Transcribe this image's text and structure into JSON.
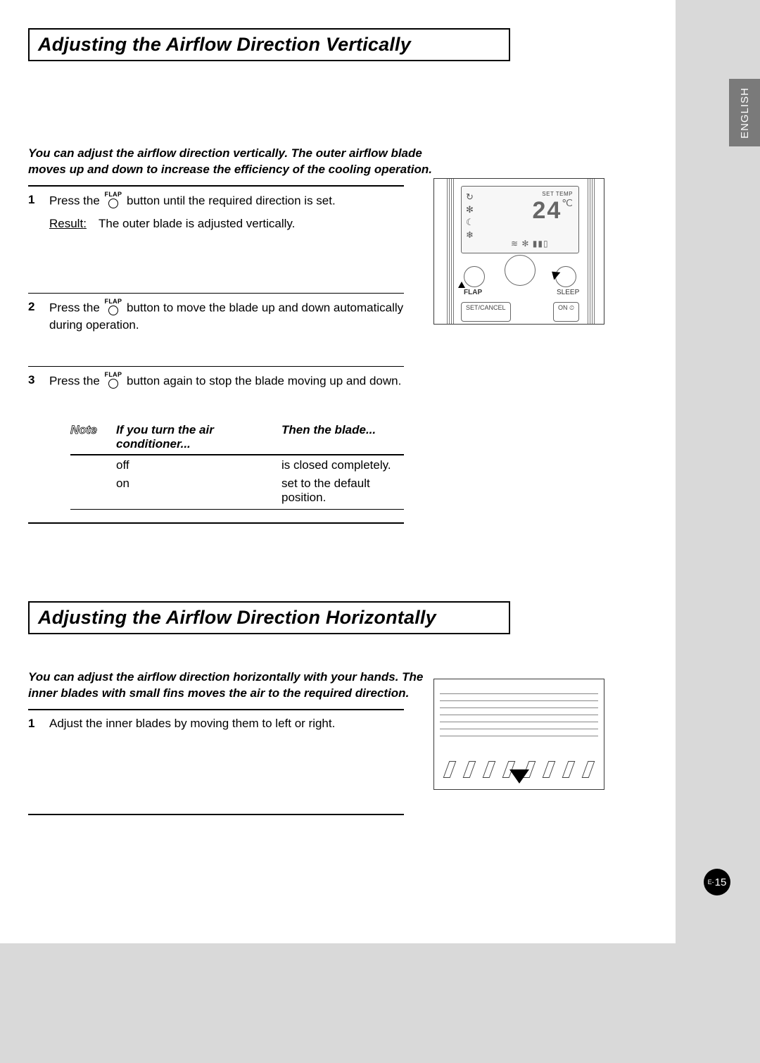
{
  "language_tab": "ENGLISH",
  "page_number": {
    "prefix": "E-",
    "num": "15"
  },
  "icons": {
    "flap_button_label": "FLAP"
  },
  "section1": {
    "title": "Adjusting the Airflow Direction Vertically",
    "intro": "You can adjust the airflow direction vertically. The outer airflow blade moves up and down to increase the efficiency of the cooling operation.",
    "steps": [
      {
        "num": "1",
        "pre": "Press the ",
        "post": " button until the required direction is set.",
        "result_label": "Result",
        "result_text": "The outer blade is adjusted vertically."
      },
      {
        "num": "2",
        "pre": "Press the ",
        "post": " button to move the blade up and down automatically during operation."
      },
      {
        "num": "3",
        "pre": "Press the ",
        "post": " button again to stop the blade moving up and down."
      }
    ],
    "note": {
      "label": "Note",
      "headers": [
        "If you turn the air conditioner...",
        "Then the blade..."
      ],
      "rows": [
        {
          "c1": "off",
          "c2": "is closed completely."
        },
        {
          "c1": "on",
          "c2": "set to the default position."
        }
      ]
    },
    "figure": {
      "set_temp_label": "SET TEMP",
      "temp_value": "24",
      "temp_unit": "℃",
      "flap_label": "FLAP",
      "sleep_label": "SLEEP",
      "set_cancel": "SET/CANCEL",
      "on_label": "ON ⏲"
    }
  },
  "section2": {
    "title": "Adjusting the Airflow Direction Horizontally",
    "intro": "You can adjust the airflow direction horizontally with your hands. The inner blades with small fins moves the air to the required direction.",
    "steps": [
      {
        "num": "1",
        "text": "Adjust the inner blades by moving them to left or right."
      }
    ]
  }
}
